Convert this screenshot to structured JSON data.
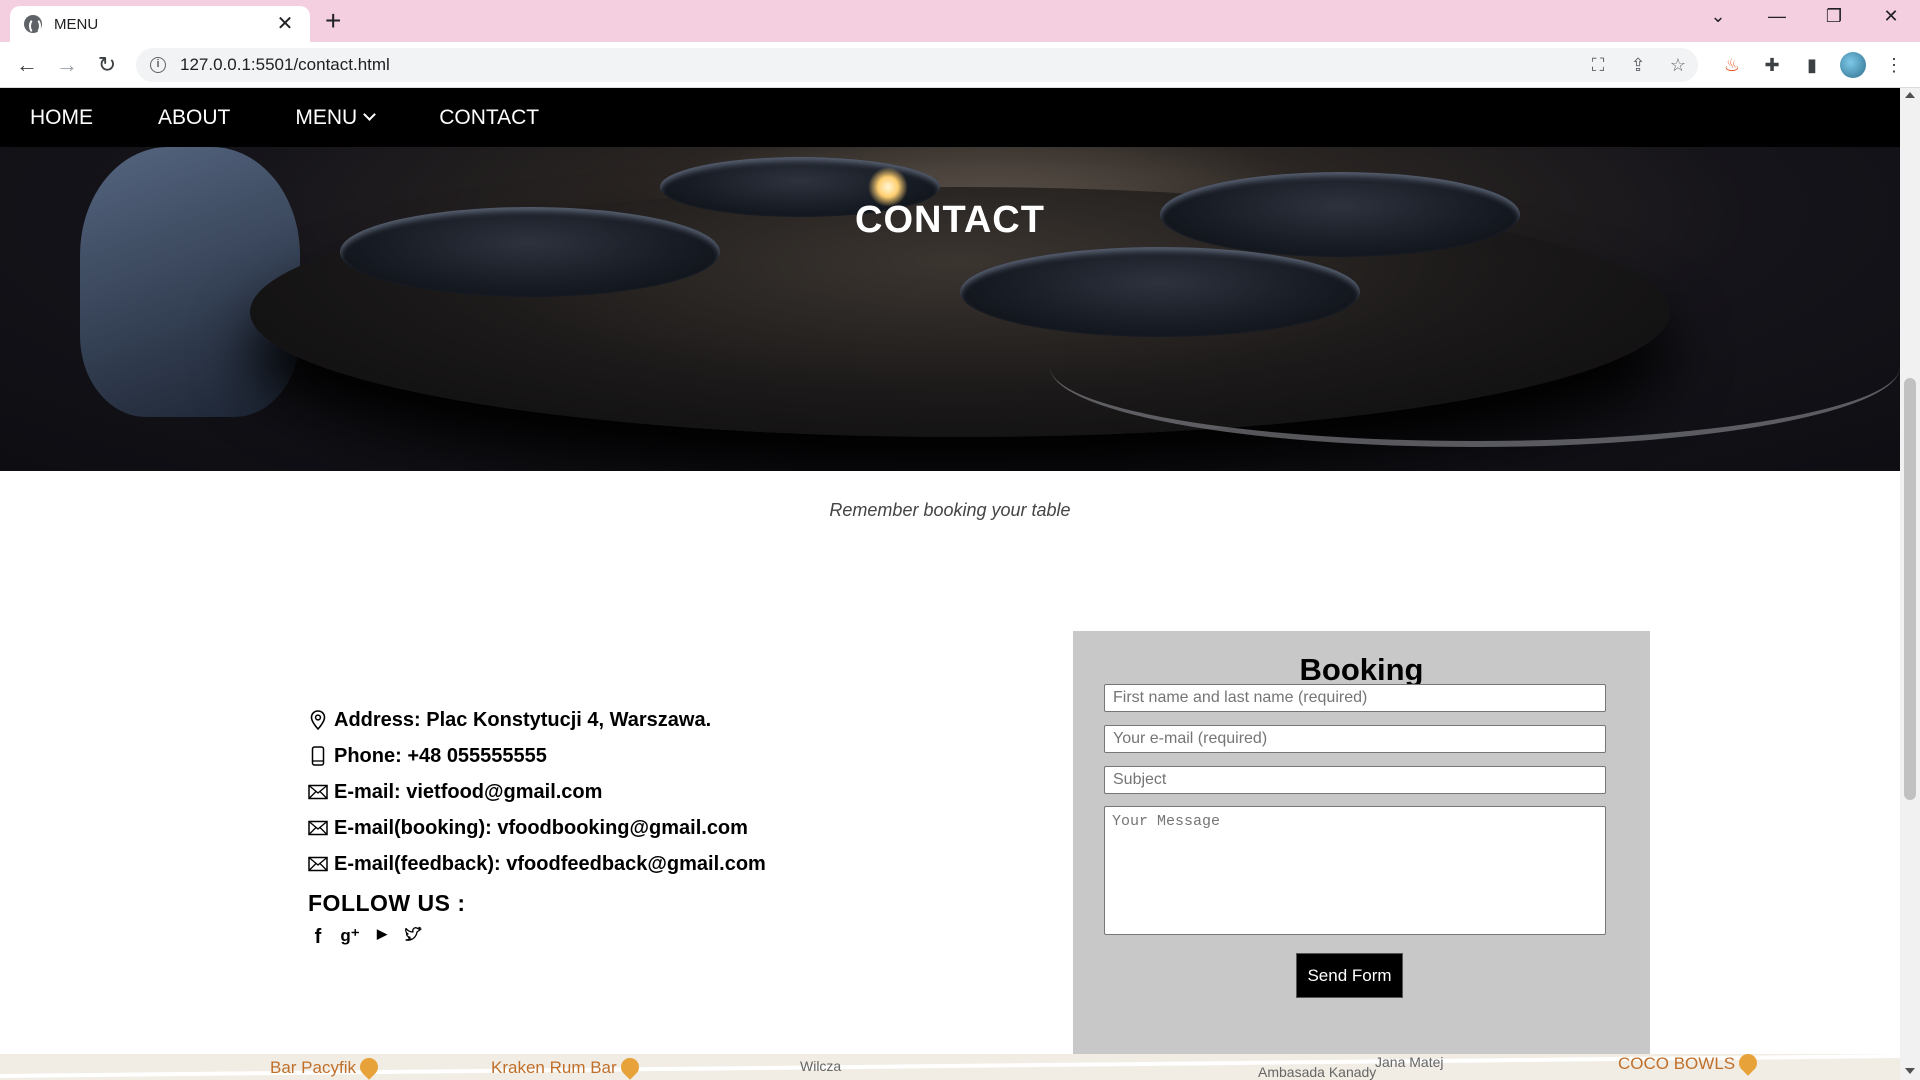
{
  "browser": {
    "tab_title": "MENU",
    "url": "127.0.0.1:5501/contact.html"
  },
  "nav": {
    "home": "HOME",
    "about": "ABOUT",
    "menu": "MENU",
    "contact": "CONTACT"
  },
  "hero": {
    "title": "CONTACT"
  },
  "subtitle": "Remember booking your table",
  "contact": {
    "address": "Address: Plac Konstytucji 4, Warszawa.",
    "phone": "Phone: +48 055555555",
    "email": "E-mail: vietfood@gmail.com",
    "email_booking": "E-mail(booking): vfoodbooking@gmail.com",
    "email_feedback": "E-mail(feedback): vfoodfeedback@gmail.com",
    "follow": "FOLLOW US :",
    "social": [
      "facebook-icon",
      "google-plus-icon",
      "youtube-icon",
      "twitter-icon"
    ]
  },
  "booking": {
    "title": "Booking",
    "name_placeholder": "First name and last name (required)",
    "email_placeholder": "Your e-mail (required)",
    "subject_placeholder": "Subject",
    "message_placeholder": "Your Message",
    "send_label": "Send Form"
  },
  "map": {
    "labels": [
      "Bar Pacyfik",
      "Kraken Rum Bar",
      "Wilcza",
      "Jana Matej",
      "Ambasada Kanady",
      "COCO BOWLS"
    ]
  },
  "colors": {
    "tabstrip": "#f4cfe0",
    "nav_bg": "#000000",
    "booking_bg": "#c8c8c8"
  }
}
